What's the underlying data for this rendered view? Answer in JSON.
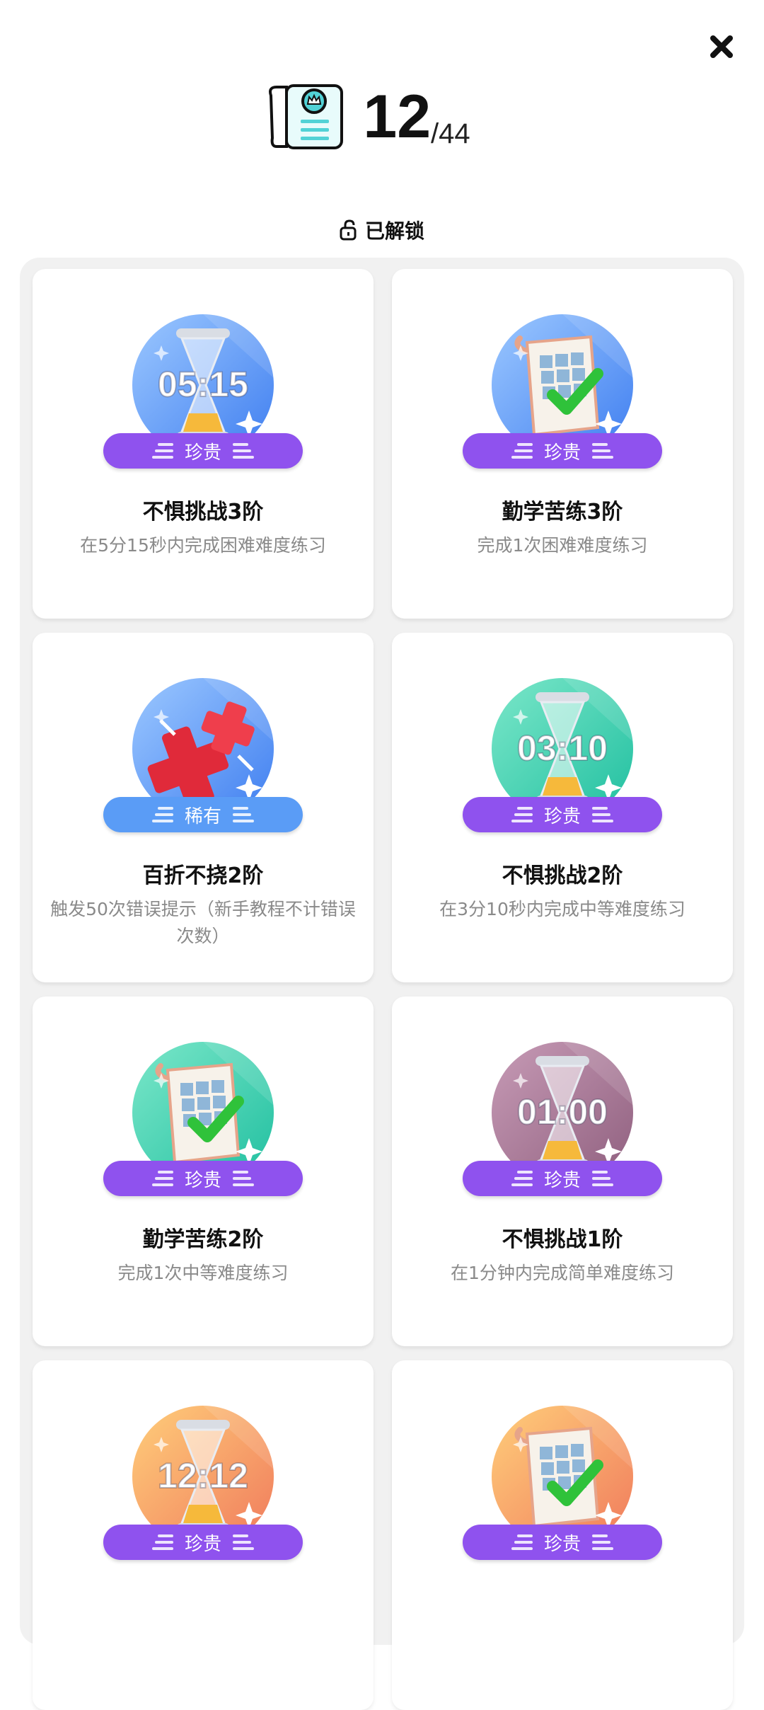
{
  "header": {
    "unlocked_count": "12",
    "total": "/44"
  },
  "section": {
    "label": "已解锁"
  },
  "colors": {
    "rare_purple": "#8f52ee",
    "rare_blue": "#5a9cf6",
    "check_green": "#2fc23a"
  },
  "cards": [
    {
      "title": "不惧挑战3阶",
      "desc": "在5分15秒内完成困难难度练习",
      "badge": "珍贵",
      "medal_icon": "hourglass-icon",
      "medal_text": "05:15",
      "theme": "blue"
    },
    {
      "title": "勤学苦练3阶",
      "desc": "完成1次困难难度练习",
      "badge": "珍贵",
      "medal_icon": "scroll-check-icon",
      "medal_text": "",
      "theme": "blue"
    },
    {
      "title": "百折不挠2阶",
      "desc": "触发50次错误提示（新手教程不计错误次数）",
      "badge": "稀有",
      "medal_icon": "red-cross-icon",
      "medal_text": "",
      "theme": "blue"
    },
    {
      "title": "不惧挑战2阶",
      "desc": "在3分10秒内完成中等难度练习",
      "badge": "珍贵",
      "medal_icon": "hourglass-icon",
      "medal_text": "03:10",
      "theme": "teal"
    },
    {
      "title": "勤学苦练2阶",
      "desc": "完成1次中等难度练习",
      "badge": "珍贵",
      "medal_icon": "scroll-check-icon",
      "medal_text": "",
      "theme": "teal"
    },
    {
      "title": "不惧挑战1阶",
      "desc": "在1分钟内完成简单难度练习",
      "badge": "珍贵",
      "medal_icon": "hourglass-icon",
      "medal_text": "01:00",
      "theme": "mauve"
    },
    {
      "title": "",
      "desc": "",
      "badge": "珍贵",
      "medal_icon": "hourglass-icon",
      "medal_text": "12:12",
      "theme": "orange"
    },
    {
      "title": "",
      "desc": "",
      "badge": "珍贵",
      "medal_icon": "scroll-check-icon",
      "medal_text": "",
      "theme": "orange"
    }
  ]
}
